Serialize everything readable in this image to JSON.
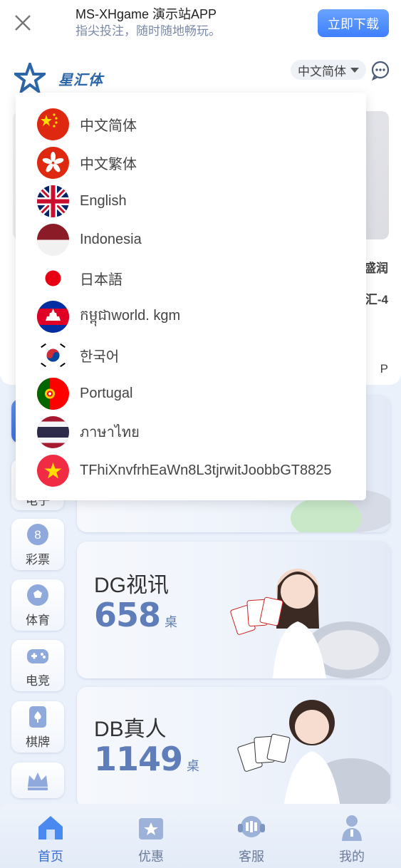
{
  "banner": {
    "title": "MS-XHgame 演示站APP",
    "subtitle": "指尖投注，随时随地畅玩。",
    "download_label": "立即下载",
    "close_icon": "close-icon"
  },
  "header": {
    "logo_text": "星汇体育",
    "language_selected": "中文简体",
    "chat_icon": "chat-icon"
  },
  "background": {
    "hero_side_texts": [
      "盛润",
      "汇-4"
    ],
    "hero_vip": "P",
    "side_tabs": [
      {
        "label": "电子",
        "icon": "slot-icon"
      },
      {
        "label": "彩票",
        "icon": "lottery-ball-icon"
      },
      {
        "label": "体育",
        "icon": "soccer-icon"
      },
      {
        "label": "电竞",
        "icon": "gamepad-icon"
      },
      {
        "label": "棋牌",
        "icon": "card-icon"
      },
      {
        "label": "",
        "icon": "crown-icon"
      }
    ],
    "games": [
      {
        "name": "DG视讯",
        "count": "658",
        "unit": "桌"
      },
      {
        "name": "DB真人",
        "count": "1149",
        "unit": "桌"
      }
    ]
  },
  "languages": [
    {
      "label": "中文简体",
      "flag": "china-flag-icon"
    },
    {
      "label": "中文繁体",
      "flag": "hongkong-flag-icon"
    },
    {
      "label": "English",
      "flag": "uk-flag-icon"
    },
    {
      "label": "Indonesia",
      "flag": "indonesia-flag-icon"
    },
    {
      "label": "日本語",
      "flag": "japan-flag-icon"
    },
    {
      "label": "កម្ពុជាworld. kgm",
      "flag": "cambodia-flag-icon"
    },
    {
      "label": "한국어",
      "flag": "korea-flag-icon"
    },
    {
      "label": "Portugal",
      "flag": "portugal-flag-icon"
    },
    {
      "label": "ภาษาไทย",
      "flag": "thailand-flag-icon"
    },
    {
      "label": "TFhiXnvfrhEaWn8L3tjrwitJoobbGT8825",
      "flag": "vietnam-flag-icon"
    }
  ],
  "bottom_nav": [
    {
      "label": "首页",
      "icon": "home-icon"
    },
    {
      "label": "优惠",
      "icon": "promo-icon"
    },
    {
      "label": "客服",
      "icon": "support-icon"
    },
    {
      "label": "我的",
      "icon": "profile-icon"
    }
  ],
  "colors": {
    "accent": "#3f7fff",
    "count_blue": "#5f7db8",
    "page_bg": "#eaf1fb"
  }
}
